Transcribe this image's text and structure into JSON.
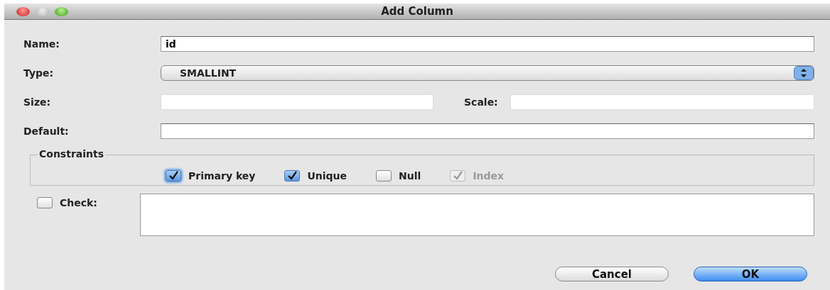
{
  "window": {
    "title": "Add Column"
  },
  "name": {
    "label": "Name:",
    "value": "id"
  },
  "type": {
    "label": "Type:",
    "value": "SMALLINT"
  },
  "size": {
    "label": "Size:"
  },
  "scale": {
    "label": "Scale:"
  },
  "default": {
    "label": "Default:"
  },
  "constraints": {
    "title": "Constraints",
    "options": [
      {
        "label": "Primary key",
        "checked": true,
        "disabled": false,
        "focused": true
      },
      {
        "label": "Unique",
        "checked": true,
        "disabled": false,
        "focused": false
      },
      {
        "label": "Null",
        "checked": false,
        "disabled": false,
        "focused": false
      },
      {
        "label": "Index",
        "checked": true,
        "disabled": true,
        "focused": false
      }
    ]
  },
  "check": {
    "label": "Check:",
    "checked": false
  },
  "buttons": [
    {
      "label": "Cancel",
      "kind": "normal"
    },
    {
      "label": "OK",
      "kind": "default"
    }
  ]
}
